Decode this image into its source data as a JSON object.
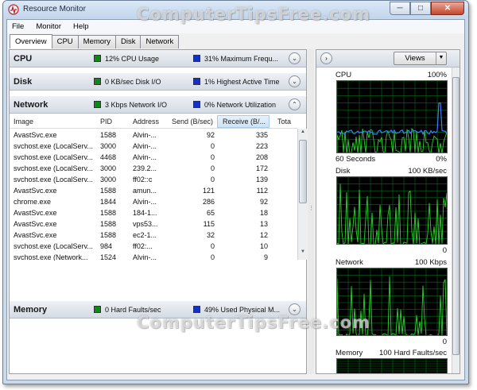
{
  "window": {
    "title": "Resource Monitor"
  },
  "menu": [
    "File",
    "Monitor",
    "Help"
  ],
  "tabs": [
    "Overview",
    "CPU",
    "Memory",
    "Disk",
    "Network"
  ],
  "colors": {
    "green": "#0b8a17",
    "blue": "#1430c8",
    "graph_bg": "#000000",
    "grid": "#0a6e1a",
    "line_green": "#2bd12b",
    "line_blue": "#3f7bff"
  },
  "sections": {
    "cpu": {
      "title": "CPU",
      "ind1": "12% CPU Usage",
      "ind2": "31% Maximum Frequ..."
    },
    "disk": {
      "title": "Disk",
      "ind1": "0 KB/sec Disk I/O",
      "ind2": "1% Highest Active Time"
    },
    "network": {
      "title": "Network",
      "ind1": "3 Kbps Network I/O",
      "ind2": "0% Network Utilization"
    },
    "memory": {
      "title": "Memory",
      "ind1": "0 Hard Faults/sec",
      "ind2": "49% Used Physical M..."
    }
  },
  "table": {
    "headers": [
      "Image",
      "PID",
      "Address",
      "Send (B/sec)",
      "Receive (B/...",
      "Tota"
    ],
    "rows": [
      [
        "AvastSvc.exe",
        "1588",
        "Alvin-...",
        "92",
        "335"
      ],
      [
        "svchost.exe (LocalServ...",
        "3000",
        "Alvin-...",
        "0",
        "223"
      ],
      [
        "svchost.exe (LocalServ...",
        "4468",
        "Alvin-...",
        "0",
        "208"
      ],
      [
        "svchost.exe (LocalServ...",
        "3000",
        "239.2...",
        "0",
        "172"
      ],
      [
        "svchost.exe (LocalServ...",
        "3000",
        "ff02::c",
        "0",
        "139"
      ],
      [
        "AvastSvc.exe",
        "1588",
        "amun...",
        "121",
        "112"
      ],
      [
        "chrome.exe",
        "1844",
        "Alvin-...",
        "286",
        "92"
      ],
      [
        "AvastSvc.exe",
        "1588",
        "184-1...",
        "65",
        "18"
      ],
      [
        "AvastSvc.exe",
        "1588",
        "vps53...",
        "115",
        "13"
      ],
      [
        "AvastSvc.exe",
        "1588",
        "ec2-1...",
        "32",
        "12"
      ],
      [
        "svchost.exe (LocalServ...",
        "984",
        "ff02:...",
        "0",
        "10"
      ],
      [
        "svchost.exe (Network...",
        "1524",
        "Alvin-...",
        "0",
        "9"
      ]
    ]
  },
  "right": {
    "views_label": "Views",
    "cpu": {
      "label": "CPU",
      "max": "100%",
      "left_bottom": "60 Seconds",
      "right_bottom": "0%"
    },
    "disk": {
      "label": "Disk",
      "max": "100 KB/sec",
      "right_bottom": "0"
    },
    "network": {
      "label": "Network",
      "max": "100 Kbps",
      "right_bottom": "0"
    },
    "memory": {
      "label": "Memory",
      "max": "100 Hard Faults/sec"
    }
  },
  "watermark": "ComputerTipsFree.com"
}
